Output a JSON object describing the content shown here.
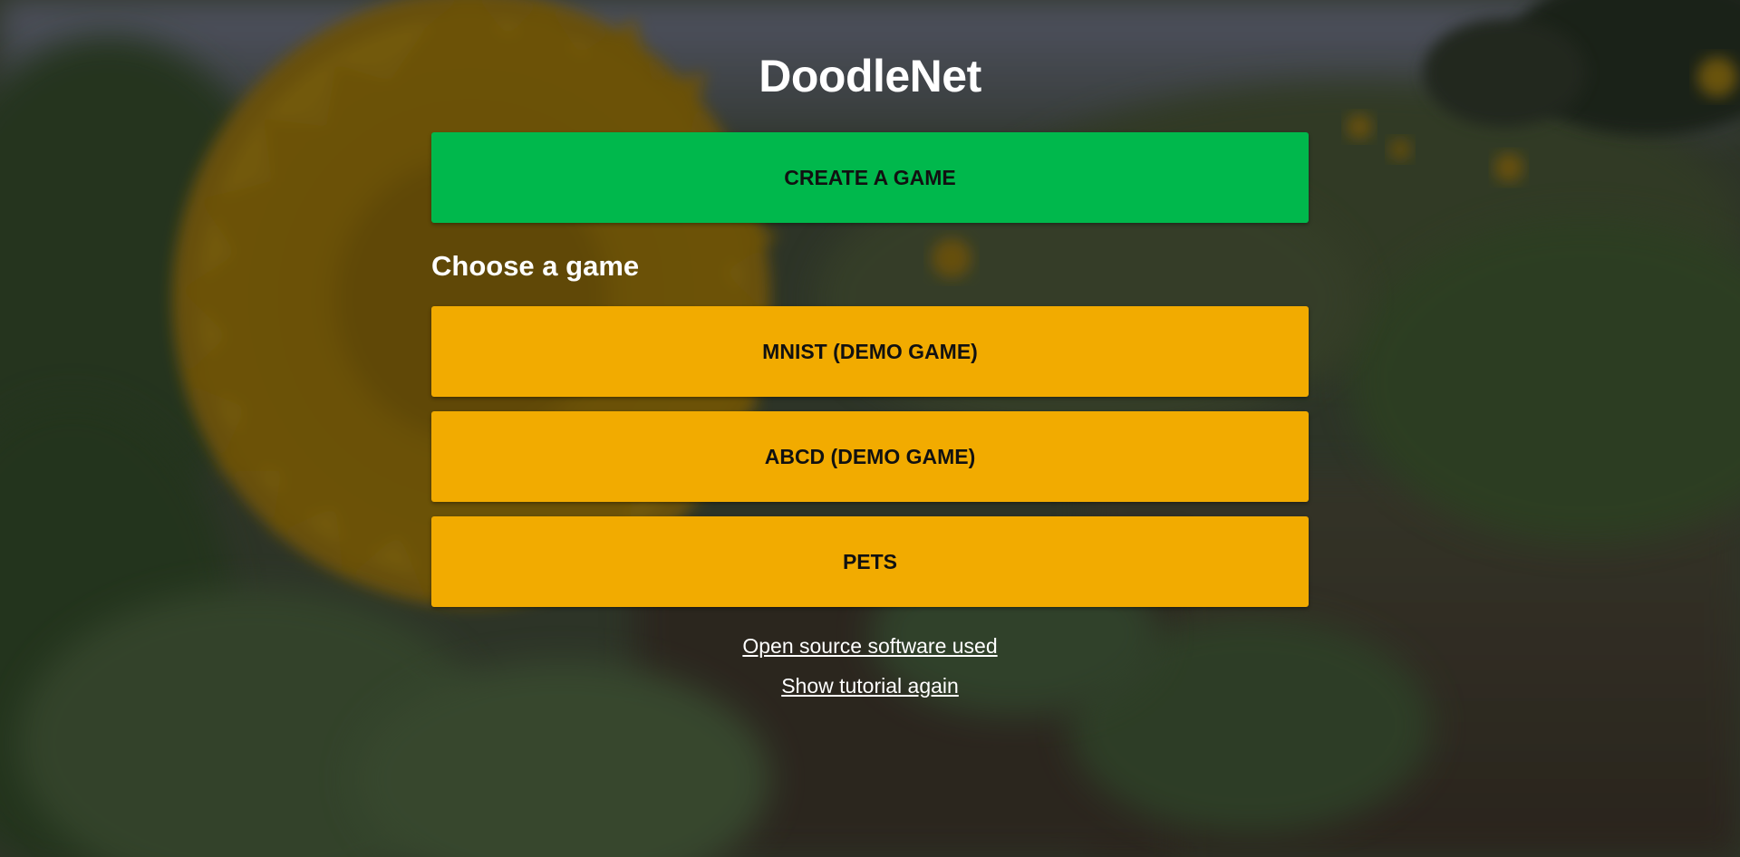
{
  "app": {
    "title": "DoodleNet"
  },
  "actions": {
    "create_game_label": "CREATE A GAME"
  },
  "games_section": {
    "heading": "Choose a game",
    "games": [
      {
        "label": "MNIST (DEMO GAME)"
      },
      {
        "label": "ABCD (DEMO GAME)"
      },
      {
        "label": "PETS"
      }
    ]
  },
  "footer_links": {
    "open_source": "Open source software used",
    "tutorial": "Show tutorial again"
  },
  "colors": {
    "create_button": "#00b84c",
    "game_button": "#f2ab00",
    "text_light": "#ffffff"
  },
  "background": {
    "description_icon": "sunflower-field-photo"
  }
}
